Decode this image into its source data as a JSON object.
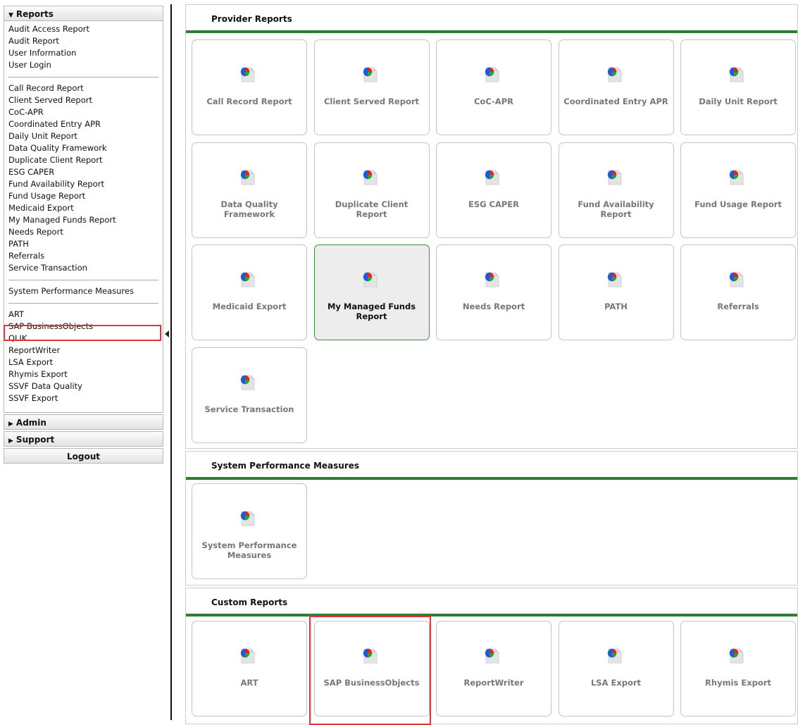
{
  "sidebar": {
    "reports_title": "Reports",
    "admin_title": "Admin",
    "support_title": "Support",
    "logout_label": "Logout",
    "group1": [
      "Audit Access Report",
      "Audit Report",
      "User Information",
      "User Login"
    ],
    "group2": [
      "Call Record Report",
      "Client Served Report",
      "CoC-APR",
      "Coordinated Entry APR",
      "Daily Unit Report",
      "Data Quality Framework",
      "Duplicate Client Report",
      "ESG CAPER",
      "Fund Availability Report",
      "Fund Usage Report",
      "Medicaid Export",
      "My Managed Funds Report",
      "Needs Report",
      "PATH",
      "Referrals",
      "Service Transaction"
    ],
    "group3": [
      "System Performance Measures"
    ],
    "group4": [
      "ART",
      "SAP BusinessObjects",
      "QLIK",
      "ReportWriter",
      "LSA Export",
      "Rhymis Export",
      "SSVF Data Quality",
      "SSVF Export"
    ]
  },
  "panels": {
    "provider": {
      "title": "Provider Reports",
      "tiles": [
        "Call Record Report",
        "Client Served Report",
        "CoC-APR",
        "Coordinated Entry APR",
        "Daily Unit Report",
        "Data Quality Framework",
        "Duplicate Client Report",
        "ESG CAPER",
        "Fund Availability Report",
        "Fund Usage Report",
        "Medicaid Export",
        "My Managed Funds Report",
        "Needs Report",
        "PATH",
        "Referrals",
        "Service Transaction"
      ]
    },
    "spm": {
      "title": "System Performance Measures",
      "tiles": [
        "System Performance Measures"
      ]
    },
    "custom": {
      "title": "Custom Reports",
      "tiles": [
        "ART",
        "SAP BusinessObjects",
        "ReportWriter",
        "LSA Export",
        "Rhymis Export"
      ]
    }
  },
  "colors": {
    "accent_green": "#2e7d32",
    "highlight_red": "#e0363b"
  },
  "icons": {
    "report_tile_icon": "report-pie-document-icon"
  }
}
